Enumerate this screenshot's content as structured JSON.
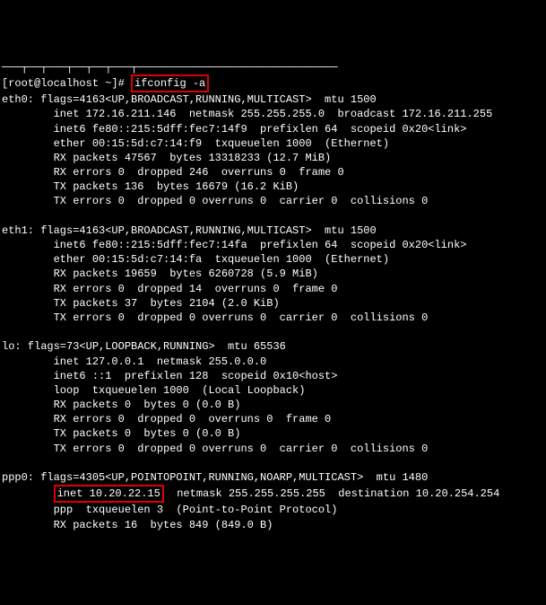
{
  "top_partial": "───┬──┬───┬──┬──┬───┬───────────────────────────────",
  "prompt": {
    "prefix": "[root@localhost ~]# ",
    "command": "ifconfig -a"
  },
  "eth0": {
    "l1": "eth0: flags=4163<UP,BROADCAST,RUNNING,MULTICAST>  mtu 1500",
    "l2": "        inet 172.16.211.146  netmask 255.255.255.0  broadcast 172.16.211.255",
    "l3": "        inet6 fe80::215:5dff:fec7:14f9  prefixlen 64  scopeid 0x20<link>",
    "l4": "        ether 00:15:5d:c7:14:f9  txqueuelen 1000  (Ethernet)",
    "l5": "        RX packets 47567  bytes 13318233 (12.7 MiB)",
    "l6": "        RX errors 0  dropped 246  overruns 0  frame 0",
    "l7": "        TX packets 136  bytes 16679 (16.2 KiB)",
    "l8": "        TX errors 0  dropped 0 overruns 0  carrier 0  collisions 0"
  },
  "eth1": {
    "l1": "eth1: flags=4163<UP,BROADCAST,RUNNING,MULTICAST>  mtu 1500",
    "l2": "        inet6 fe80::215:5dff:fec7:14fa  prefixlen 64  scopeid 0x20<link>",
    "l3": "        ether 00:15:5d:c7:14:fa  txqueuelen 1000  (Ethernet)",
    "l4": "        RX packets 19659  bytes 6260728 (5.9 MiB)",
    "l5": "        RX errors 0  dropped 14  overruns 0  frame 0",
    "l6": "        TX packets 37  bytes 2104 (2.0 KiB)",
    "l7": "        TX errors 0  dropped 0 overruns 0  carrier 0  collisions 0"
  },
  "lo": {
    "l1": "lo: flags=73<UP,LOOPBACK,RUNNING>  mtu 65536",
    "l2": "        inet 127.0.0.1  netmask 255.0.0.0",
    "l3": "        inet6 ::1  prefixlen 128  scopeid 0x10<host>",
    "l4": "        loop  txqueuelen 1000  (Local Loopback)",
    "l5": "        RX packets 0  bytes 0 (0.0 B)",
    "l6": "        RX errors 0  dropped 0  overruns 0  frame 0",
    "l7": "        TX packets 0  bytes 0 (0.0 B)",
    "l8": "        TX errors 0  dropped 0 overruns 0  carrier 0  collisions 0"
  },
  "ppp0": {
    "l1_pre": "ppp0: flags=4305<UP,POINTOPOINT,RUNNING,NOARP,MULTICAST>  mtu 1480",
    "l2_pre": "        ",
    "l2_hl": "inet 10.20.22.15",
    "l2_post": "  netmask 255.255.255.255  destination 10.20.254.254",
    "l3": "        ppp  txqueuelen 3  (Point-to-Point Protocol)",
    "l4": "        RX packets 16  bytes 849 (849.0 B)"
  }
}
